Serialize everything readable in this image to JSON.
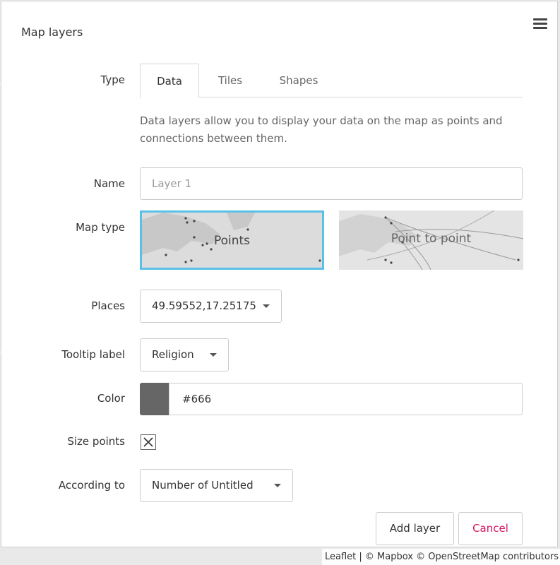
{
  "panel": {
    "title": "Map layers",
    "menu_icon": "hamburger-menu-icon"
  },
  "type_row": {
    "label": "Type",
    "tabs": [
      {
        "label": "Data",
        "active": true
      },
      {
        "label": "Tiles",
        "active": false
      },
      {
        "label": "Shapes",
        "active": false
      }
    ],
    "description": "Data layers allow you to display your data on the map as points and connections between them."
  },
  "name_row": {
    "label": "Name",
    "placeholder": "Layer 1",
    "value": ""
  },
  "map_type_row": {
    "label": "Map type",
    "options": [
      {
        "label": "Points",
        "selected": true
      },
      {
        "label": "Point to point",
        "selected": false
      }
    ]
  },
  "places_row": {
    "label": "Places",
    "selected": "49.59552,17.25175"
  },
  "tooltip_row": {
    "label": "Tooltip label",
    "selected": "Religion"
  },
  "color_row": {
    "label": "Color",
    "value": "#666",
    "swatch_color": "#666666"
  },
  "size_points_row": {
    "label": "Size points",
    "checked": true
  },
  "according_row": {
    "label": "According to",
    "selected": "Number of Untitled"
  },
  "buttons": {
    "add_layer": "Add layer",
    "cancel": "Cancel"
  },
  "attribution": "Leaflet | © Mapbox © OpenStreetMap contributors",
  "colors": {
    "selected_border": "#5bc0e8",
    "cancel_text": "#d6145f"
  }
}
